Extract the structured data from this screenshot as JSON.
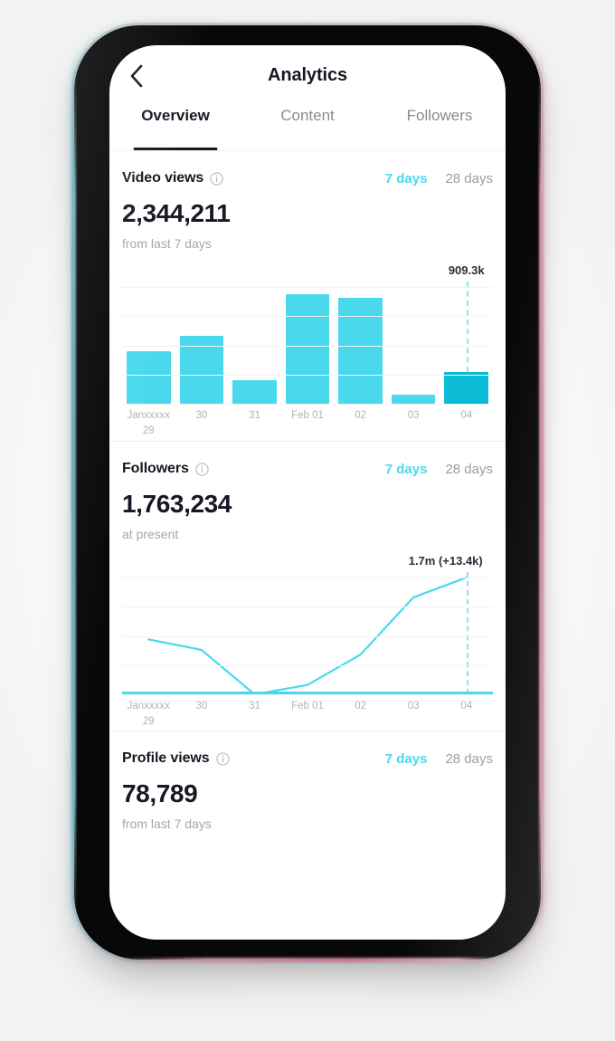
{
  "device": {
    "frame_color": "#080808",
    "rim_left_color": "#6aaab6",
    "rim_right_color": "#cf8ba8"
  },
  "navbar": {
    "back_icon": "chevron-left-icon",
    "title": "Analytics"
  },
  "tabs": [
    {
      "label": "Overview",
      "active": true
    },
    {
      "label": "Content",
      "active": false
    },
    {
      "label": "Followers",
      "active": false
    }
  ],
  "theme": {
    "accent": "#4ad9ec",
    "accent_dark": "#0cbcd6",
    "text_primary": "#161823",
    "text_muted": "#a5a6ab",
    "gridline": "#f3f3f4"
  },
  "sections": [
    {
      "title": "Video views",
      "info_icon": "info-circle-icon",
      "ranges": [
        {
          "label": "7 days",
          "selected": true
        },
        {
          "label": "28 days",
          "selected": false
        }
      ],
      "value": "2,344,211",
      "subtitle": "from last 7 days",
      "peak_label": "909.3k"
    },
    {
      "title": "Followers",
      "info_icon": "info-circle-icon",
      "ranges": [
        {
          "label": "7 days",
          "selected": true
        },
        {
          "label": "28 days",
          "selected": false
        }
      ],
      "value": "1,763,234",
      "subtitle": "at present",
      "peak_label": "1.7m (+13.4k)"
    },
    {
      "title": "Profile views",
      "info_icon": "info-circle-icon",
      "ranges": [
        {
          "label": "7 days",
          "selected": true
        },
        {
          "label": "28 days",
          "selected": false
        }
      ],
      "value": "78,789",
      "subtitle": "from last 7 days"
    }
  ],
  "chart_data": [
    {
      "type": "bar",
      "title": "Video views",
      "categories": [
        "Janxxxxx 29",
        "30",
        "31",
        "Feb 01",
        "02",
        "03",
        "04"
      ],
      "tick_lines": [
        [
          "Janxxxxx",
          "29"
        ],
        [
          "30",
          ""
        ],
        [
          "31",
          ""
        ],
        [
          "Feb 01",
          ""
        ],
        [
          "02",
          ""
        ],
        [
          "03",
          ""
        ],
        [
          "04",
          ""
        ]
      ],
      "values": [
        435000,
        560000,
        195000,
        910000,
        880000,
        75000,
        260000
      ],
      "value_fractions": [
        0.45,
        0.58,
        0.2,
        0.94,
        0.91,
        0.08,
        0.27
      ],
      "highlight_index": 6,
      "annotation": "909.3k",
      "annotation_index": 6,
      "xlabel": "",
      "ylabel": "",
      "ylim": [
        0,
        970000
      ],
      "grid": true,
      "gridline_count": 5,
      "legend": "none",
      "bar_color": "#4ad9ec",
      "highlight_color": "#0cbcd6"
    },
    {
      "type": "line",
      "title": "Followers",
      "categories": [
        "Janxxxxx 29",
        "30",
        "31",
        "Feb 01",
        "02",
        "03",
        "04"
      ],
      "tick_lines": [
        [
          "Janxxxxx",
          "29"
        ],
        [
          "30",
          ""
        ],
        [
          "31",
          ""
        ],
        [
          "Feb 01",
          ""
        ],
        [
          "02",
          ""
        ],
        [
          "03",
          ""
        ],
        [
          "04",
          ""
        ]
      ],
      "value_fractions": [
        0.47,
        0.38,
        0.0,
        0.08,
        0.34,
        0.83,
        1.0
      ],
      "annotation": "1.7m (+13.4k)",
      "annotation_index": 6,
      "xlabel": "",
      "ylabel": "",
      "grid": true,
      "gridline_count": 5,
      "legend": "none",
      "line_color": "#4ad9ec"
    }
  ]
}
